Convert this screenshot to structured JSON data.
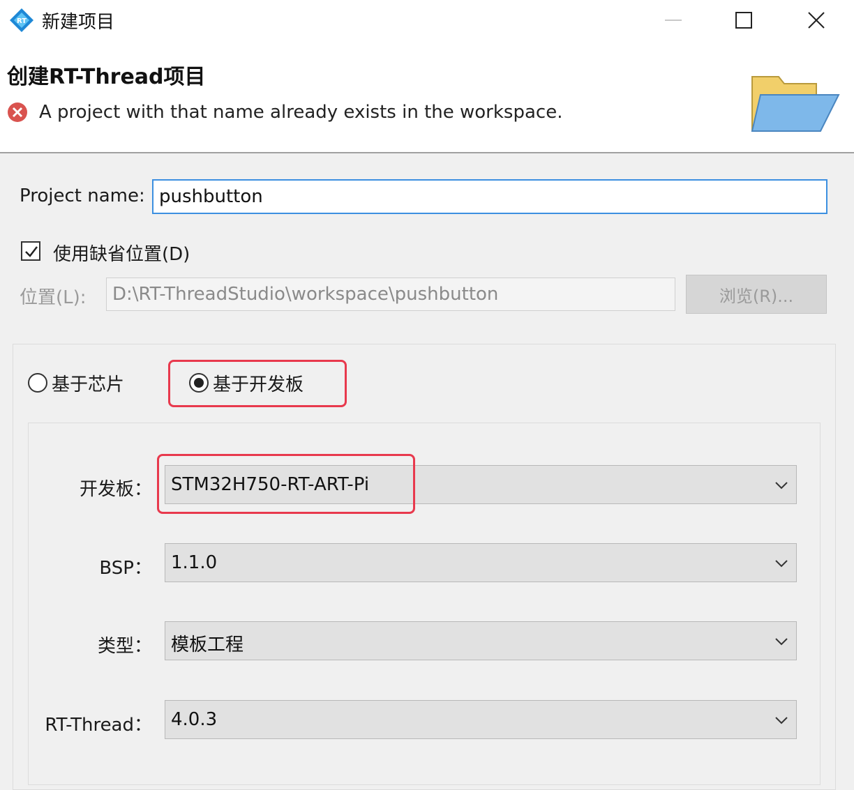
{
  "window": {
    "title": "新建项目"
  },
  "header": {
    "title": "创建RT-Thread项目",
    "error_message": "A project with that name already exists in the workspace."
  },
  "form": {
    "project_name_label": "Project name:",
    "project_name_value": "pushbutton",
    "use_default_location_label": "使用缺省位置(D)",
    "use_default_location_checked": true,
    "location_label": "位置(L):",
    "location_value": "D:\\RT-ThreadStudio\\workspace\\pushbutton",
    "browse_label": "浏览(R)..."
  },
  "mode": {
    "chip_label": "基于芯片",
    "board_label": "基于开发板",
    "selected": "board"
  },
  "fields": {
    "board_label": "开发板：",
    "board_value": "STM32H750-RT-ART-Pi",
    "bsp_label": "BSP：",
    "bsp_value": "1.1.0",
    "type_label": "类型：",
    "type_value": "模板工程",
    "rtthread_label": "RT-Thread：",
    "rtthread_value": "4.0.3"
  },
  "colors": {
    "highlight": "#e8394d",
    "focus_border": "#3c8fe0",
    "error_red": "#d9534f"
  }
}
